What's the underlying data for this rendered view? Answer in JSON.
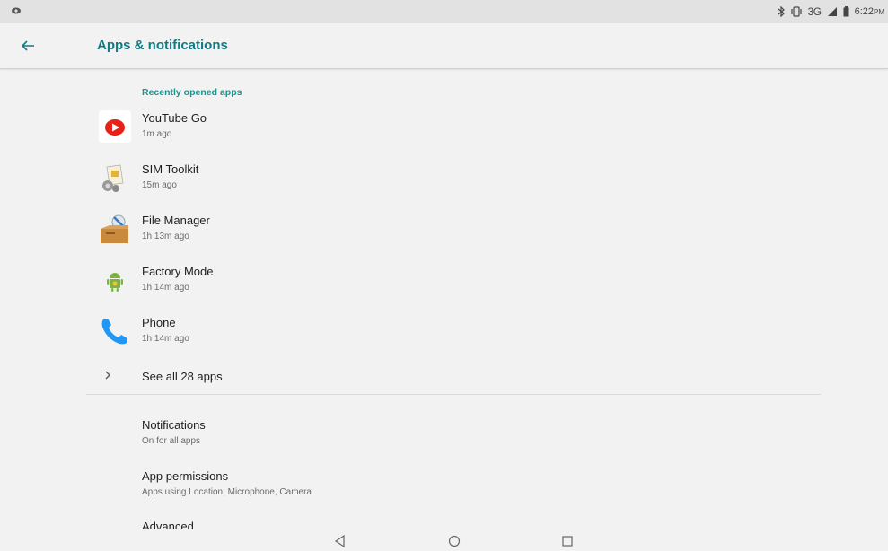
{
  "status_bar": {
    "left_icon": "vpn-key-icon",
    "bluetooth_icon": "bluetooth-icon",
    "vibrate_icon": "vibrate-icon",
    "network": "3G",
    "battery_icon": "battery-icon",
    "time": "6:22",
    "ampm": "PM"
  },
  "header": {
    "back_icon": "back-arrow-icon",
    "title": "Apps & notifications"
  },
  "recent": {
    "header": "Recently opened apps",
    "apps": [
      {
        "name": "YouTube Go",
        "time": "1m ago",
        "icon": "youtube-go-icon"
      },
      {
        "name": "SIM Toolkit",
        "time": "15m ago",
        "icon": "sim-toolkit-icon"
      },
      {
        "name": "File Manager",
        "time": "1h 13m ago",
        "icon": "file-manager-icon"
      },
      {
        "name": "Factory Mode",
        "time": "1h 14m ago",
        "icon": "android-icon"
      },
      {
        "name": "Phone",
        "time": "1h 14m ago",
        "icon": "phone-icon"
      }
    ],
    "see_all": "See all 28 apps"
  },
  "settings": [
    {
      "title": "Notifications",
      "subtitle": "On for all apps"
    },
    {
      "title": "App permissions",
      "subtitle": "Apps using Location, Microphone, Camera"
    },
    {
      "title": "Advanced",
      "subtitle": ""
    }
  ],
  "colors": {
    "accent": "#127a83",
    "section_header": "#19948e",
    "youtube_red": "#e62117",
    "phone_blue": "#2196f3",
    "android_green": "#7cb342"
  },
  "nav": {
    "back_icon": "nav-back-icon",
    "home_icon": "nav-home-icon",
    "recents_icon": "nav-recents-icon"
  }
}
